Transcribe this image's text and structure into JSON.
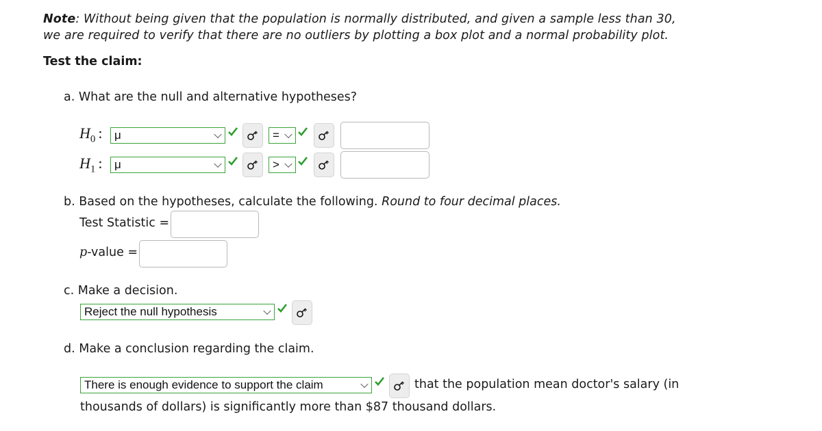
{
  "note": {
    "label": "Note",
    "text_line1": ": Without being given that the population is normally distributed, and given a sample less than 30,",
    "text_line2": "we are required to verify that there are no outliers by plotting a box plot and a normal probability plot."
  },
  "test_claim_heading": "Test the claim:",
  "part_a": {
    "question": "a. What are the null and alternative hypotheses?",
    "h0": {
      "label_main": "H",
      "label_sub": "0",
      "colon": ":",
      "parameter": "μ",
      "operator": "=",
      "value": ""
    },
    "h1": {
      "label_main": "H",
      "label_sub": "1",
      "colon": ":",
      "parameter": "μ",
      "operator": ">",
      "value": ""
    }
  },
  "part_b": {
    "question_plain": "b. Based on the hypotheses, calculate the following. ",
    "question_italic": "Round to four decimal places.",
    "test_statistic_label": "Test Statistic =",
    "test_statistic_value": "",
    "p_value_label_italic": "p",
    "p_value_label_rest": "-value =",
    "p_value_value": ""
  },
  "part_c": {
    "question": "c. Make a decision.",
    "decision": "Reject the null hypothesis"
  },
  "part_d": {
    "question": "d. Make a conclusion regarding the claim.",
    "conclusion": "There is enough evidence to support the claim",
    "text_after": "that the population mean doctor's salary (in",
    "text_line2": "thousands of dollars) is significantly more than $87 thousand dollars."
  },
  "icons": {
    "correct": "checkmark-icon",
    "key": "key-icon"
  },
  "colors": {
    "correct_green": "#2e9e2e",
    "select_border": "#3aa33a"
  }
}
